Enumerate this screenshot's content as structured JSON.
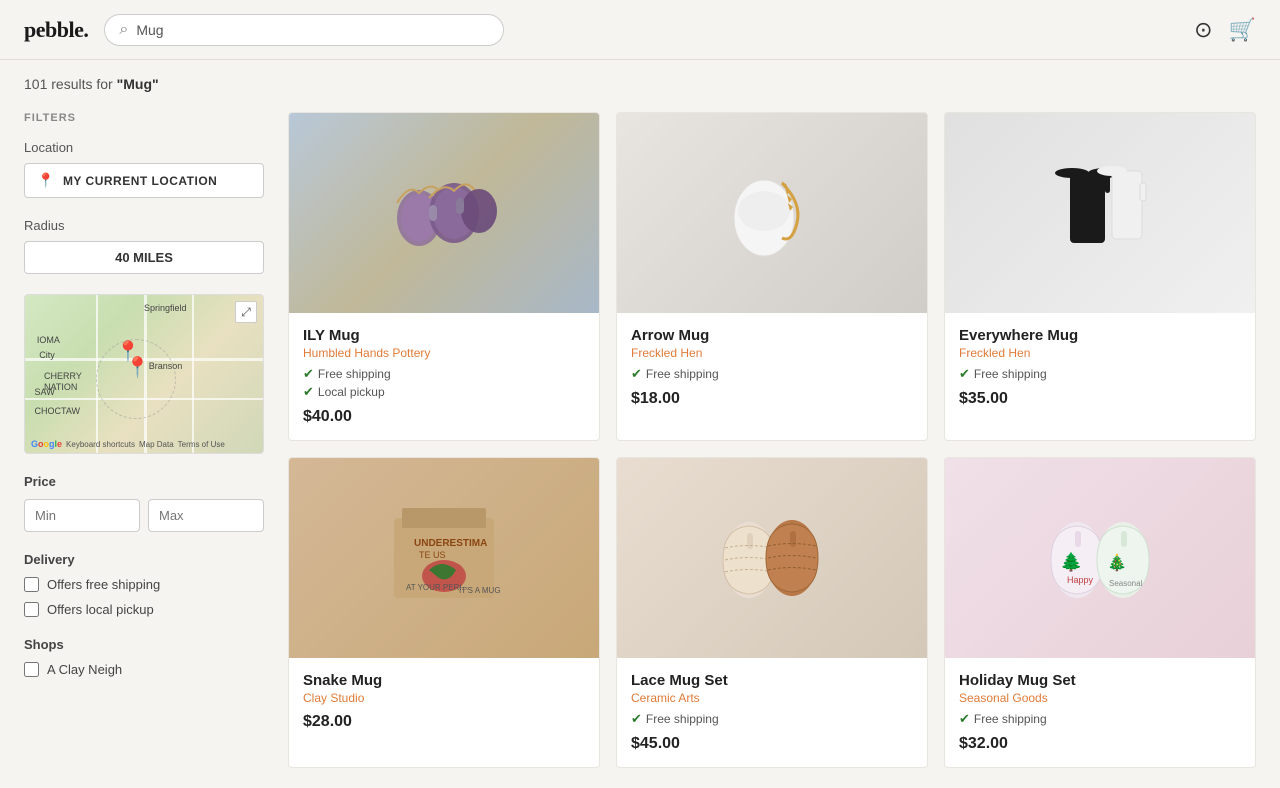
{
  "header": {
    "logo": "pebble.",
    "search_placeholder": "Mug",
    "search_value": "Mug"
  },
  "results": {
    "count": "101",
    "query": "\"Mug\""
  },
  "filters": {
    "title": "FILTERS",
    "location": {
      "label": "Location",
      "button": "MY CURRENT LOCATION"
    },
    "radius": {
      "label": "Radius",
      "value": "40 MILES"
    },
    "price": {
      "label": "Price",
      "min_placeholder": "Min",
      "max_placeholder": "Max"
    },
    "delivery": {
      "label": "Delivery",
      "free_shipping_label": "Offers free shipping",
      "local_pickup_label": "Offers local pickup"
    },
    "shops": {
      "label": "Shops",
      "shop1": "A Clay Neigh"
    }
  },
  "products": [
    {
      "name": "ILY Mug",
      "shop": "Humbled Hands Pottery",
      "free_shipping": true,
      "local_pickup": true,
      "price": "$40.00",
      "color": "#c8a878"
    },
    {
      "name": "Arrow Mug",
      "shop": "Freckled Hen",
      "free_shipping": true,
      "local_pickup": false,
      "price": "$18.00",
      "color": "#e8e4e0"
    },
    {
      "name": "Everywhere Mug",
      "shop": "Freckled Hen",
      "free_shipping": true,
      "local_pickup": false,
      "price": "$35.00",
      "color": "#e0e0e0"
    },
    {
      "name": "Snake Mug",
      "shop": "Clay Studio",
      "free_shipping": false,
      "local_pickup": false,
      "price": "$28.00",
      "color": "#d4b896"
    },
    {
      "name": "Lace Mug Set",
      "shop": "Ceramic Arts",
      "free_shipping": true,
      "local_pickup": false,
      "price": "$45.00",
      "color": "#e0d4c4"
    },
    {
      "name": "Holiday Mug Set",
      "shop": "Seasonal Goods",
      "free_shipping": true,
      "local_pickup": false,
      "price": "$32.00",
      "color": "#f0d8e0"
    }
  ],
  "icons": {
    "search": "🔍",
    "location_pin": "📍",
    "check": "✓",
    "user": "👤",
    "cart": "🛒",
    "expand": "⤢"
  }
}
